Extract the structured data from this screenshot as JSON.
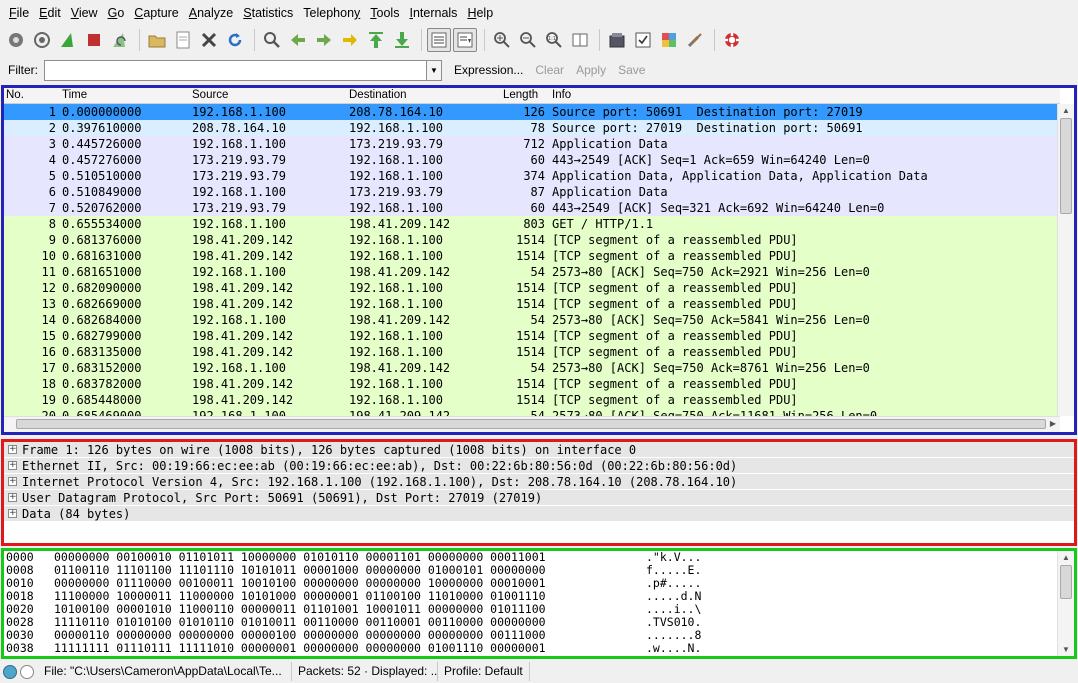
{
  "menu": [
    {
      "pre": "",
      "u": "F",
      "post": "ile"
    },
    {
      "pre": "",
      "u": "E",
      "post": "dit"
    },
    {
      "pre": "",
      "u": "V",
      "post": "iew"
    },
    {
      "pre": "",
      "u": "G",
      "post": "o"
    },
    {
      "pre": "",
      "u": "C",
      "post": "apture"
    },
    {
      "pre": "",
      "u": "A",
      "post": "nalyze"
    },
    {
      "pre": "",
      "u": "S",
      "post": "tatistics"
    },
    {
      "pre": "Telephon",
      "u": "y",
      "post": ""
    },
    {
      "pre": "",
      "u": "T",
      "post": "ools"
    },
    {
      "pre": "",
      "u": "I",
      "post": "nternals"
    },
    {
      "pre": "",
      "u": "H",
      "post": "elp"
    }
  ],
  "filter": {
    "label": "Filter:",
    "value": "",
    "expression": "Expression...",
    "clear": "Clear",
    "apply": "Apply",
    "save": "Save"
  },
  "packet_list": {
    "columns": {
      "no": "No.",
      "time": "Time",
      "source": "Source",
      "destination": "Destination",
      "length": "Length",
      "info": "Info"
    },
    "rows": [
      {
        "no": "1",
        "time": "0.000000000",
        "src": "192.168.1.100",
        "dst": "208.78.164.10",
        "len": "126",
        "info": "Source port: 50691  Destination port: 27019",
        "color": "#3399ff"
      },
      {
        "no": "2",
        "time": "0.397610000",
        "src": "208.78.164.10",
        "dst": "192.168.1.100",
        "len": "78",
        "info": "Source port: 27019  Destination port: 50691",
        "color": "#daeeff"
      },
      {
        "no": "3",
        "time": "0.445726000",
        "src": "192.168.1.100",
        "dst": "173.219.93.79",
        "len": "712",
        "info": "Application Data",
        "color": "#e7e6ff"
      },
      {
        "no": "4",
        "time": "0.457276000",
        "src": "173.219.93.79",
        "dst": "192.168.1.100",
        "len": "60",
        "info": "443→2549 [ACK] Seq=1 Ack=659 Win=64240 Len=0",
        "color": "#e7e6ff"
      },
      {
        "no": "5",
        "time": "0.510510000",
        "src": "173.219.93.79",
        "dst": "192.168.1.100",
        "len": "374",
        "info": "Application Data, Application Data, Application Data",
        "color": "#e7e6ff"
      },
      {
        "no": "6",
        "time": "0.510849000",
        "src": "192.168.1.100",
        "dst": "173.219.93.79",
        "len": "87",
        "info": "Application Data",
        "color": "#e7e6ff"
      },
      {
        "no": "7",
        "time": "0.520762000",
        "src": "173.219.93.79",
        "dst": "192.168.1.100",
        "len": "60",
        "info": "443→2549 [ACK] Seq=321 Ack=692 Win=64240 Len=0",
        "color": "#e7e6ff"
      },
      {
        "no": "8",
        "time": "0.655534000",
        "src": "192.168.1.100",
        "dst": "198.41.209.142",
        "len": "803",
        "info": "GET / HTTP/1.1",
        "color": "#e4ffc7"
      },
      {
        "no": "9",
        "time": "0.681376000",
        "src": "198.41.209.142",
        "dst": "192.168.1.100",
        "len": "1514",
        "info": "[TCP segment of a reassembled PDU]",
        "color": "#e4ffc7"
      },
      {
        "no": "10",
        "time": "0.681631000",
        "src": "198.41.209.142",
        "dst": "192.168.1.100",
        "len": "1514",
        "info": "[TCP segment of a reassembled PDU]",
        "color": "#e4ffc7"
      },
      {
        "no": "11",
        "time": "0.681651000",
        "src": "192.168.1.100",
        "dst": "198.41.209.142",
        "len": "54",
        "info": "2573→80 [ACK] Seq=750 Ack=2921 Win=256 Len=0",
        "color": "#e4ffc7"
      },
      {
        "no": "12",
        "time": "0.682090000",
        "src": "198.41.209.142",
        "dst": "192.168.1.100",
        "len": "1514",
        "info": "[TCP segment of a reassembled PDU]",
        "color": "#e4ffc7"
      },
      {
        "no": "13",
        "time": "0.682669000",
        "src": "198.41.209.142",
        "dst": "192.168.1.100",
        "len": "1514",
        "info": "[TCP segment of a reassembled PDU]",
        "color": "#e4ffc7"
      },
      {
        "no": "14",
        "time": "0.682684000",
        "src": "192.168.1.100",
        "dst": "198.41.209.142",
        "len": "54",
        "info": "2573→80 [ACK] Seq=750 Ack=5841 Win=256 Len=0",
        "color": "#e4ffc7"
      },
      {
        "no": "15",
        "time": "0.682799000",
        "src": "198.41.209.142",
        "dst": "192.168.1.100",
        "len": "1514",
        "info": "[TCP segment of a reassembled PDU]",
        "color": "#e4ffc7"
      },
      {
        "no": "16",
        "time": "0.683135000",
        "src": "198.41.209.142",
        "dst": "192.168.1.100",
        "len": "1514",
        "info": "[TCP segment of a reassembled PDU]",
        "color": "#e4ffc7"
      },
      {
        "no": "17",
        "time": "0.683152000",
        "src": "192.168.1.100",
        "dst": "198.41.209.142",
        "len": "54",
        "info": "2573→80 [ACK] Seq=750 Ack=8761 Win=256 Len=0",
        "color": "#e4ffc7"
      },
      {
        "no": "18",
        "time": "0.683782000",
        "src": "198.41.209.142",
        "dst": "192.168.1.100",
        "len": "1514",
        "info": "[TCP segment of a reassembled PDU]",
        "color": "#e4ffc7"
      },
      {
        "no": "19",
        "time": "0.685448000",
        "src": "198.41.209.142",
        "dst": "192.168.1.100",
        "len": "1514",
        "info": "[TCP segment of a reassembled PDU]",
        "color": "#e4ffc7"
      },
      {
        "no": "20",
        "time": "0.685469000",
        "src": "192.168.1.100",
        "dst": "198.41.209.142",
        "len": "54",
        "info": "2573→80 [ACK] Seq=750 Ack=11681 Win=256 Len=0",
        "color": "#e4ffc7"
      }
    ]
  },
  "details": [
    "Frame 1: 126 bytes on wire (1008 bits), 126 bytes captured (1008 bits) on interface 0",
    "Ethernet II, Src: 00:19:66:ec:ee:ab (00:19:66:ec:ee:ab), Dst: 00:22:6b:80:56:0d (00:22:6b:80:56:0d)",
    "Internet Protocol Version 4, Src: 192.168.1.100 (192.168.1.100), Dst: 208.78.164.10 (208.78.164.10)",
    "User Datagram Protocol, Src Port: 50691 (50691), Dst Port: 27019 (27019)",
    "Data (84 bytes)"
  ],
  "bytes": [
    {
      "off": "0000",
      "bits": "00000000 00100010 01101011 10000000 01010110 00001101 00000000 00011001",
      "ascii": ".\"k.V..."
    },
    {
      "off": "0008",
      "bits": "01100110 11101100 11101110 10101011 00001000 00000000 01000101 00000000",
      "ascii": "f.....E."
    },
    {
      "off": "0010",
      "bits": "00000000 01110000 00100011 10010100 00000000 00000000 10000000 00010001",
      "ascii": ".p#....."
    },
    {
      "off": "0018",
      "bits": "11100000 10000011 11000000 10101000 00000001 01100100 11010000 01001110",
      "ascii": ".....d.N"
    },
    {
      "off": "0020",
      "bits": "10100100 00001010 11000110 00000011 01101001 10001011 00000000 01011100",
      "ascii": "....i..\\"
    },
    {
      "off": "0028",
      "bits": "11110110 01010100 01010110 01010011 00110000 00110001 00110000 00000000",
      "ascii": ".TVS010."
    },
    {
      "off": "0030",
      "bits": "00000110 00000000 00000000 00000100 00000000 00000000 00000000 00111000",
      "ascii": ".......8"
    },
    {
      "off": "0038",
      "bits": "11111111 01110111 11111010 00000001 00000000 00000000 01001110 00000001",
      "ascii": ".w....N."
    }
  ],
  "status": {
    "file": "File: \"C:\\Users\\Cameron\\AppData\\Local\\Te...",
    "packets": "Packets: 52 · Displayed: ...",
    "profile": "Profile: Default"
  },
  "colors": {
    "list_border": "#2323b5",
    "details_border": "#e01818",
    "bytes_border": "#18c818",
    "selected_row": "#3399ff"
  }
}
